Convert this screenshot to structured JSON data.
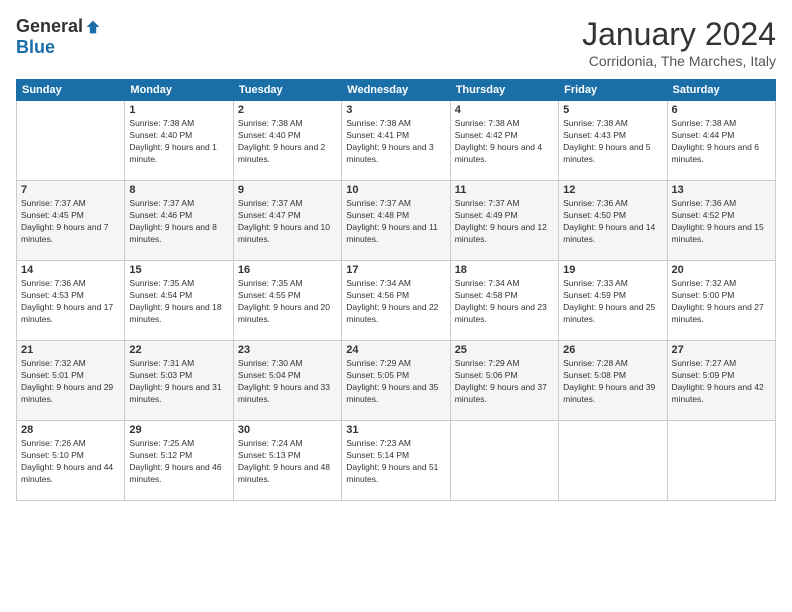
{
  "logo": {
    "general": "General",
    "blue": "Blue"
  },
  "title": "January 2024",
  "subtitle": "Corridonia, The Marches, Italy",
  "days_header": [
    "Sunday",
    "Monday",
    "Tuesday",
    "Wednesday",
    "Thursday",
    "Friday",
    "Saturday"
  ],
  "weeks": [
    [
      {
        "day": "",
        "sunrise": "",
        "sunset": "",
        "daylight": ""
      },
      {
        "day": "1",
        "sunrise": "Sunrise: 7:38 AM",
        "sunset": "Sunset: 4:40 PM",
        "daylight": "Daylight: 9 hours and 1 minute."
      },
      {
        "day": "2",
        "sunrise": "Sunrise: 7:38 AM",
        "sunset": "Sunset: 4:40 PM",
        "daylight": "Daylight: 9 hours and 2 minutes."
      },
      {
        "day": "3",
        "sunrise": "Sunrise: 7:38 AM",
        "sunset": "Sunset: 4:41 PM",
        "daylight": "Daylight: 9 hours and 3 minutes."
      },
      {
        "day": "4",
        "sunrise": "Sunrise: 7:38 AM",
        "sunset": "Sunset: 4:42 PM",
        "daylight": "Daylight: 9 hours and 4 minutes."
      },
      {
        "day": "5",
        "sunrise": "Sunrise: 7:38 AM",
        "sunset": "Sunset: 4:43 PM",
        "daylight": "Daylight: 9 hours and 5 minutes."
      },
      {
        "day": "6",
        "sunrise": "Sunrise: 7:38 AM",
        "sunset": "Sunset: 4:44 PM",
        "daylight": "Daylight: 9 hours and 6 minutes."
      }
    ],
    [
      {
        "day": "7",
        "sunrise": "Sunrise: 7:37 AM",
        "sunset": "Sunset: 4:45 PM",
        "daylight": "Daylight: 9 hours and 7 minutes."
      },
      {
        "day": "8",
        "sunrise": "Sunrise: 7:37 AM",
        "sunset": "Sunset: 4:46 PM",
        "daylight": "Daylight: 9 hours and 8 minutes."
      },
      {
        "day": "9",
        "sunrise": "Sunrise: 7:37 AM",
        "sunset": "Sunset: 4:47 PM",
        "daylight": "Daylight: 9 hours and 10 minutes."
      },
      {
        "day": "10",
        "sunrise": "Sunrise: 7:37 AM",
        "sunset": "Sunset: 4:48 PM",
        "daylight": "Daylight: 9 hours and 11 minutes."
      },
      {
        "day": "11",
        "sunrise": "Sunrise: 7:37 AM",
        "sunset": "Sunset: 4:49 PM",
        "daylight": "Daylight: 9 hours and 12 minutes."
      },
      {
        "day": "12",
        "sunrise": "Sunrise: 7:36 AM",
        "sunset": "Sunset: 4:50 PM",
        "daylight": "Daylight: 9 hours and 14 minutes."
      },
      {
        "day": "13",
        "sunrise": "Sunrise: 7:36 AM",
        "sunset": "Sunset: 4:52 PM",
        "daylight": "Daylight: 9 hours and 15 minutes."
      }
    ],
    [
      {
        "day": "14",
        "sunrise": "Sunrise: 7:36 AM",
        "sunset": "Sunset: 4:53 PM",
        "daylight": "Daylight: 9 hours and 17 minutes."
      },
      {
        "day": "15",
        "sunrise": "Sunrise: 7:35 AM",
        "sunset": "Sunset: 4:54 PM",
        "daylight": "Daylight: 9 hours and 18 minutes."
      },
      {
        "day": "16",
        "sunrise": "Sunrise: 7:35 AM",
        "sunset": "Sunset: 4:55 PM",
        "daylight": "Daylight: 9 hours and 20 minutes."
      },
      {
        "day": "17",
        "sunrise": "Sunrise: 7:34 AM",
        "sunset": "Sunset: 4:56 PM",
        "daylight": "Daylight: 9 hours and 22 minutes."
      },
      {
        "day": "18",
        "sunrise": "Sunrise: 7:34 AM",
        "sunset": "Sunset: 4:58 PM",
        "daylight": "Daylight: 9 hours and 23 minutes."
      },
      {
        "day": "19",
        "sunrise": "Sunrise: 7:33 AM",
        "sunset": "Sunset: 4:59 PM",
        "daylight": "Daylight: 9 hours and 25 minutes."
      },
      {
        "day": "20",
        "sunrise": "Sunrise: 7:32 AM",
        "sunset": "Sunset: 5:00 PM",
        "daylight": "Daylight: 9 hours and 27 minutes."
      }
    ],
    [
      {
        "day": "21",
        "sunrise": "Sunrise: 7:32 AM",
        "sunset": "Sunset: 5:01 PM",
        "daylight": "Daylight: 9 hours and 29 minutes."
      },
      {
        "day": "22",
        "sunrise": "Sunrise: 7:31 AM",
        "sunset": "Sunset: 5:03 PM",
        "daylight": "Daylight: 9 hours and 31 minutes."
      },
      {
        "day": "23",
        "sunrise": "Sunrise: 7:30 AM",
        "sunset": "Sunset: 5:04 PM",
        "daylight": "Daylight: 9 hours and 33 minutes."
      },
      {
        "day": "24",
        "sunrise": "Sunrise: 7:29 AM",
        "sunset": "Sunset: 5:05 PM",
        "daylight": "Daylight: 9 hours and 35 minutes."
      },
      {
        "day": "25",
        "sunrise": "Sunrise: 7:29 AM",
        "sunset": "Sunset: 5:06 PM",
        "daylight": "Daylight: 9 hours and 37 minutes."
      },
      {
        "day": "26",
        "sunrise": "Sunrise: 7:28 AM",
        "sunset": "Sunset: 5:08 PM",
        "daylight": "Daylight: 9 hours and 39 minutes."
      },
      {
        "day": "27",
        "sunrise": "Sunrise: 7:27 AM",
        "sunset": "Sunset: 5:09 PM",
        "daylight": "Daylight: 9 hours and 42 minutes."
      }
    ],
    [
      {
        "day": "28",
        "sunrise": "Sunrise: 7:26 AM",
        "sunset": "Sunset: 5:10 PM",
        "daylight": "Daylight: 9 hours and 44 minutes."
      },
      {
        "day": "29",
        "sunrise": "Sunrise: 7:25 AM",
        "sunset": "Sunset: 5:12 PM",
        "daylight": "Daylight: 9 hours and 46 minutes."
      },
      {
        "day": "30",
        "sunrise": "Sunrise: 7:24 AM",
        "sunset": "Sunset: 5:13 PM",
        "daylight": "Daylight: 9 hours and 48 minutes."
      },
      {
        "day": "31",
        "sunrise": "Sunrise: 7:23 AM",
        "sunset": "Sunset: 5:14 PM",
        "daylight": "Daylight: 9 hours and 51 minutes."
      },
      {
        "day": "",
        "sunrise": "",
        "sunset": "",
        "daylight": ""
      },
      {
        "day": "",
        "sunrise": "",
        "sunset": "",
        "daylight": ""
      },
      {
        "day": "",
        "sunrise": "",
        "sunset": "",
        "daylight": ""
      }
    ]
  ]
}
